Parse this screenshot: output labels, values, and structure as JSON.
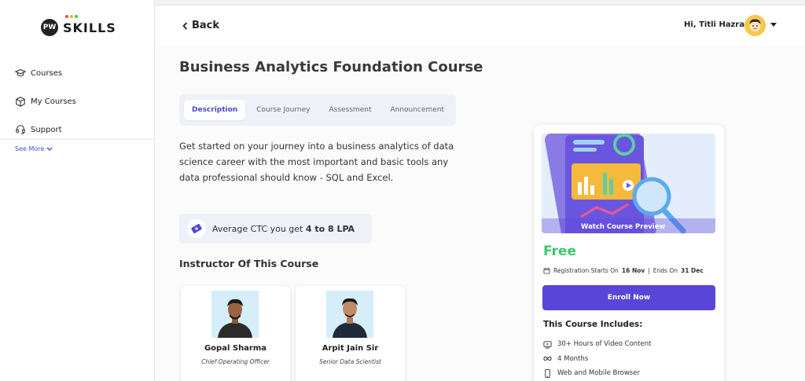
{
  "brand": {
    "logo_text": "SKILLS",
    "logo_mark": "PW"
  },
  "sidebar": {
    "items": [
      {
        "label": "Courses",
        "icon": "graduation-cap-icon"
      },
      {
        "label": "My Courses",
        "icon": "book-box-icon"
      },
      {
        "label": "Support",
        "icon": "headset-icon"
      }
    ],
    "see_more": "See More"
  },
  "header": {
    "back_label": "Back",
    "greeting": "Hi, Titli Hazra"
  },
  "course": {
    "title": "Business Analytics Foundation Course",
    "tabs": [
      {
        "label": "Description",
        "active": true
      },
      {
        "label": "Course Journey",
        "active": false
      },
      {
        "label": "Assessment",
        "active": false
      },
      {
        "label": "Announcement",
        "active": false
      }
    ],
    "description": "Get started on your journey into a business analytics of data science career with the most important and basic tools any data professional should know - SQL and Excel.",
    "ctc_prefix": "Average CTC you get",
    "ctc_value": "4 to 8 LPA",
    "instructor_heading": "Instructor Of This Course",
    "instructors": [
      {
        "name": "Gopal Sharma",
        "role": "Chief Operating Officer"
      },
      {
        "name": "Arpit Jain Sir",
        "role": "Senior Data Scientist"
      }
    ]
  },
  "enroll_card": {
    "preview_label": "Watch Course Preview",
    "price": "Free",
    "reg_starts_prefix": "Registration Starts On",
    "reg_start_date": "16 Nov",
    "reg_separator": "|",
    "reg_ends_prefix": "Ends On",
    "reg_end_date": "31 Dec",
    "enroll_label": "Enroll Now",
    "includes_title": "This Course Includes:",
    "includes": [
      {
        "label": "30+ Hours of Video Content",
        "icon": "video-icon"
      },
      {
        "label": "4 Months",
        "icon": "infinity-icon"
      },
      {
        "label": "Web and Mobile Browser",
        "icon": "mobile-icon"
      }
    ]
  },
  "colors": {
    "accent": "#5a45d9",
    "tab_active": "#4b47c8",
    "price_green": "#3cc86e",
    "link_blue": "#3b56c9"
  }
}
